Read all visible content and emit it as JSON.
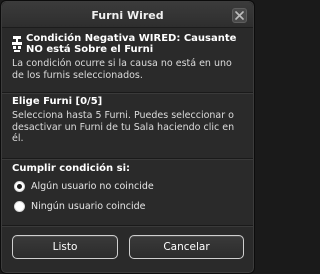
{
  "window": {
    "title": "Furni Wired"
  },
  "condition": {
    "title": "Condición Negativa WIRED: Causante NO está Sobre el Furni",
    "description": "La condición ocurre si la causa no está en uno de los furnis seleccionados."
  },
  "furni_select": {
    "title": "Elige Furni [0/5]",
    "description": "Selecciona hasta 5 Furni. Puedes seleccionar o desactivar un Furni de tu Sala haciendo clic en él."
  },
  "options": {
    "title": "Cumplir condición si:",
    "items": [
      {
        "label": "Algún usuario no coincide",
        "selected": true
      },
      {
        "label": "Ningún usuario coincide",
        "selected": false
      }
    ]
  },
  "buttons": {
    "ok_label": "Listo",
    "cancel_label": "Cancelar"
  },
  "icons": {
    "close": "close-icon",
    "wired": "wired-icon"
  }
}
